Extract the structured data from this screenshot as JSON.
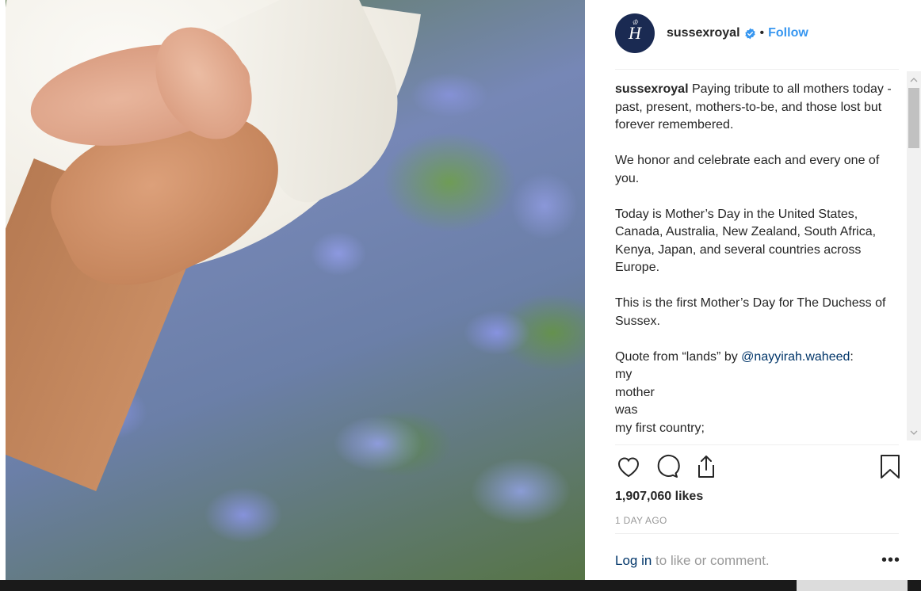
{
  "post": {
    "username": "sussexroyal",
    "follow_label": "Follow",
    "separator": "•",
    "avatar_monogram": "H"
  },
  "caption": {
    "username": "sussexroyal",
    "p1": "Paying tribute to all mothers today - past, present, mothers-to-be, and those lost but forever remembered.",
    "p2": "We honor and celebrate each and every one of you.",
    "p3": "Today is Mother’s Day in the United States, Canada, Australia, New Zealand, South Africa, Kenya, Japan, and several countries across Europe.",
    "p4": "This is the first Mother’s Day for The Duchess of Sussex.",
    "quote_prefix": "Quote from “lands” by ",
    "quote_mention": "@nayyirah.waheed",
    "quote_suffix": ":",
    "poem": [
      "my",
      "mother",
      "was",
      "my first country;"
    ]
  },
  "engagement": {
    "likes": "1,907,060 likes",
    "time_ago": "1 DAY AGO"
  },
  "login_prompt": {
    "login_link": "Log in",
    "rest": " to like or comment.",
    "more": "•••"
  },
  "icons": [
    "heart-icon",
    "comment-icon",
    "share-icon",
    "bookmark-icon",
    "verified-badge-icon",
    "more-options-icon"
  ],
  "colors": {
    "link_blue": "#3897f0",
    "mention_navy": "#003569",
    "text": "#262626",
    "muted": "#999999",
    "avatar_bg": "#1a2a52"
  }
}
